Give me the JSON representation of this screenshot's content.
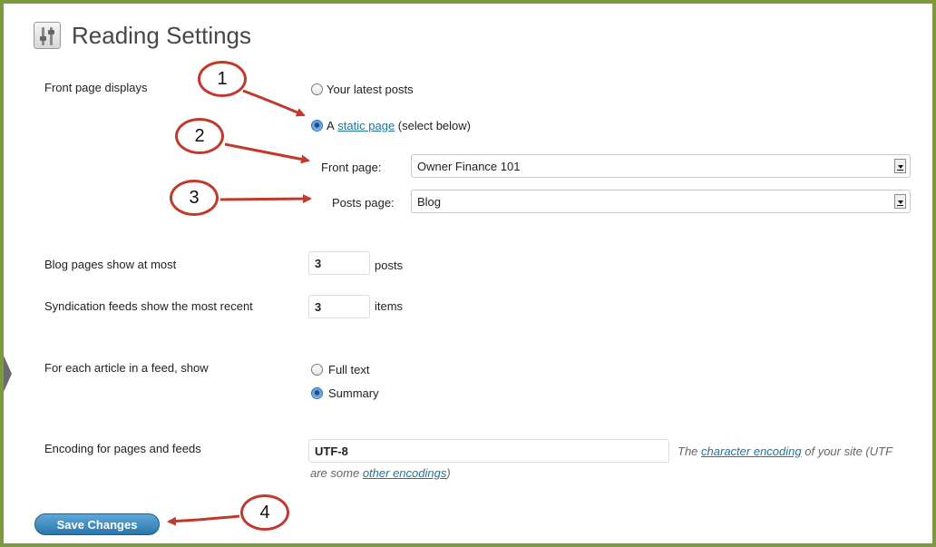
{
  "page": {
    "title": "Reading Settings"
  },
  "front_page": {
    "label": "Front page displays",
    "option_latest": "Your latest posts",
    "option_static_prefix": "A",
    "option_static_link": "static page",
    "option_static_suffix": "(select below)",
    "front_page_label": "Front page:",
    "front_page_value": "Owner Finance 101",
    "posts_page_label": "Posts page:",
    "posts_page_value": "Blog"
  },
  "blog_pages": {
    "label": "Blog pages show at most",
    "value": "3",
    "unit": "posts"
  },
  "syndication": {
    "label": "Syndication feeds show the most recent",
    "value": "3",
    "unit": "items"
  },
  "feed_article": {
    "label": "For each article in a feed, show",
    "option_full": "Full text",
    "option_summary": "Summary"
  },
  "encoding": {
    "label": "Encoding for pages and feeds",
    "value": "UTF-8",
    "note_prefix": "The",
    "note_link": "character encoding",
    "note_suffix": "of your site (UTF",
    "note_line2_prefix": "are some",
    "note_line2_link": "other encodings",
    "note_line2_suffix": ")"
  },
  "actions": {
    "save_label": "Save Changes"
  },
  "callouts": [
    "1",
    "2",
    "3",
    "4"
  ],
  "colors": {
    "frame": "#7d9a3f",
    "callout": "#c0392b",
    "link": "#21759b",
    "button": "#2a77ad"
  }
}
